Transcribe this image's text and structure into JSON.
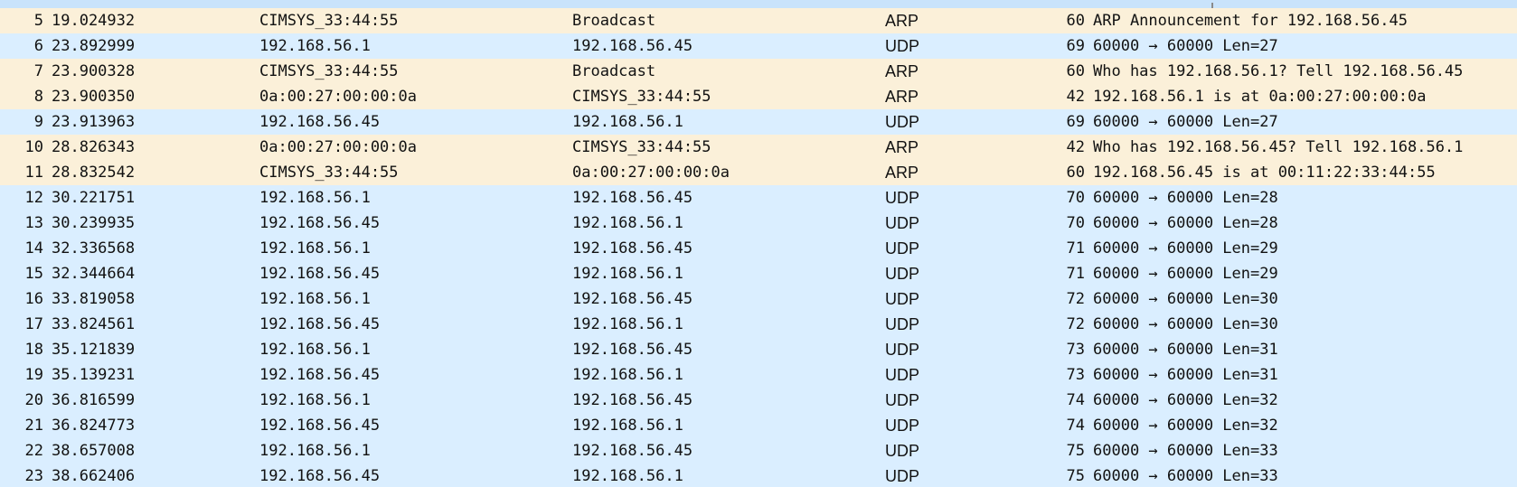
{
  "colors": {
    "arp_row": "#fbf0d9",
    "udp_row": "#daeeff",
    "text": "#121212"
  },
  "packets": [
    {
      "no": "5",
      "time": "19.024932",
      "source": "CIMSYS_33:44:55",
      "destination": "Broadcast",
      "protocol": "ARP",
      "length": "60",
      "info": "ARP Announcement for 192.168.56.45"
    },
    {
      "no": "6",
      "time": "23.892999",
      "source": "192.168.56.1",
      "destination": "192.168.56.45",
      "protocol": "UDP",
      "length": "69",
      "info": "60000 → 60000 Len=27"
    },
    {
      "no": "7",
      "time": "23.900328",
      "source": "CIMSYS_33:44:55",
      "destination": "Broadcast",
      "protocol": "ARP",
      "length": "60",
      "info": "Who has 192.168.56.1? Tell 192.168.56.45"
    },
    {
      "no": "8",
      "time": "23.900350",
      "source": "0a:00:27:00:00:0a",
      "destination": "CIMSYS_33:44:55",
      "protocol": "ARP",
      "length": "42",
      "info": "192.168.56.1 is at 0a:00:27:00:00:0a"
    },
    {
      "no": "9",
      "time": "23.913963",
      "source": "192.168.56.45",
      "destination": "192.168.56.1",
      "protocol": "UDP",
      "length": "69",
      "info": "60000 → 60000 Len=27"
    },
    {
      "no": "10",
      "time": "28.826343",
      "source": "0a:00:27:00:00:0a",
      "destination": "CIMSYS_33:44:55",
      "protocol": "ARP",
      "length": "42",
      "info": "Who has 192.168.56.45? Tell 192.168.56.1"
    },
    {
      "no": "11",
      "time": "28.832542",
      "source": "CIMSYS_33:44:55",
      "destination": "0a:00:27:00:00:0a",
      "protocol": "ARP",
      "length": "60",
      "info": "192.168.56.45 is at 00:11:22:33:44:55"
    },
    {
      "no": "12",
      "time": "30.221751",
      "source": "192.168.56.1",
      "destination": "192.168.56.45",
      "protocol": "UDP",
      "length": "70",
      "info": "60000 → 60000 Len=28"
    },
    {
      "no": "13",
      "time": "30.239935",
      "source": "192.168.56.45",
      "destination": "192.168.56.1",
      "protocol": "UDP",
      "length": "70",
      "info": "60000 → 60000 Len=28"
    },
    {
      "no": "14",
      "time": "32.336568",
      "source": "192.168.56.1",
      "destination": "192.168.56.45",
      "protocol": "UDP",
      "length": "71",
      "info": "60000 → 60000 Len=29"
    },
    {
      "no": "15",
      "time": "32.344664",
      "source": "192.168.56.45",
      "destination": "192.168.56.1",
      "protocol": "UDP",
      "length": "71",
      "info": "60000 → 60000 Len=29"
    },
    {
      "no": "16",
      "time": "33.819058",
      "source": "192.168.56.1",
      "destination": "192.168.56.45",
      "protocol": "UDP",
      "length": "72",
      "info": "60000 → 60000 Len=30"
    },
    {
      "no": "17",
      "time": "33.824561",
      "source": "192.168.56.45",
      "destination": "192.168.56.1",
      "protocol": "UDP",
      "length": "72",
      "info": "60000 → 60000 Len=30"
    },
    {
      "no": "18",
      "time": "35.121839",
      "source": "192.168.56.1",
      "destination": "192.168.56.45",
      "protocol": "UDP",
      "length": "73",
      "info": "60000 → 60000 Len=31"
    },
    {
      "no": "19",
      "time": "35.139231",
      "source": "192.168.56.45",
      "destination": "192.168.56.1",
      "protocol": "UDP",
      "length": "73",
      "info": "60000 → 60000 Len=31"
    },
    {
      "no": "20",
      "time": "36.816599",
      "source": "192.168.56.1",
      "destination": "192.168.56.45",
      "protocol": "UDP",
      "length": "74",
      "info": "60000 → 60000 Len=32"
    },
    {
      "no": "21",
      "time": "36.824773",
      "source": "192.168.56.45",
      "destination": "192.168.56.1",
      "protocol": "UDP",
      "length": "74",
      "info": "60000 → 60000 Len=32"
    },
    {
      "no": "22",
      "time": "38.657008",
      "source": "192.168.56.1",
      "destination": "192.168.56.45",
      "protocol": "UDP",
      "length": "75",
      "info": "60000 → 60000 Len=33"
    },
    {
      "no": "23",
      "time": "38.662406",
      "source": "192.168.56.45",
      "destination": "192.168.56.1",
      "protocol": "UDP",
      "length": "75",
      "info": "60000 → 60000 Len=33"
    }
  ]
}
